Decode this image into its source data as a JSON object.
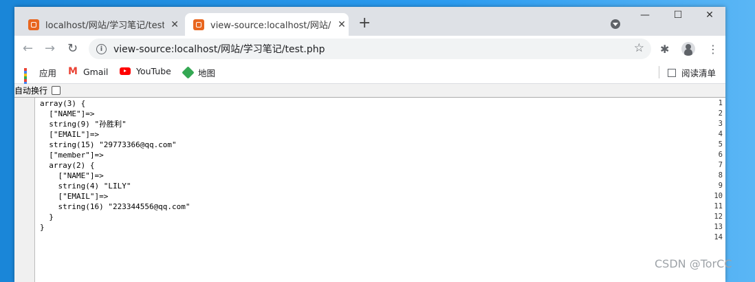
{
  "tabs": [
    {
      "title": "localhost/网站/学习笔记/test.php",
      "active": false
    },
    {
      "title": "view-source:localhost/网站/学习笔记/test.php",
      "active": true
    }
  ],
  "window_controls": {
    "minimize": "—",
    "maximize": "☐",
    "close": "✕"
  },
  "toolbar": {
    "back": "←",
    "forward": "→",
    "reload": "↻",
    "url": "view-source:localhost/网站/学习笔记/test.php",
    "star": "☆",
    "extensions": "✱",
    "menu": "⋮"
  },
  "bookmarks": [
    {
      "label": "应用",
      "icon": "apps-grid-icon"
    },
    {
      "label": "Gmail",
      "icon": "gmail-icon"
    },
    {
      "label": "YouTube",
      "icon": "youtube-icon"
    },
    {
      "label": "地图",
      "icon": "maps-icon"
    }
  ],
  "reading_list": "阅读清单",
  "source_view": {
    "wrap_label": "自动换行",
    "wrap_checked": false,
    "lines": [
      "array(3) {",
      "  [\"NAME\"]=>",
      "  string(9) \"孙胜利\"",
      "  [\"EMAIL\"]=>",
      "  string(15) \"29773366@qq.com\"",
      "  [\"member\"]=>",
      "  array(2) {",
      "    [\"NAME\"]=>",
      "    string(4) \"LILY\"",
      "    [\"EMAIL\"]=>",
      "    string(16) \"223344556@qq.com\"",
      "  }",
      "}",
      ""
    ]
  },
  "watermark": "CSDN @TorCC",
  "colors": {
    "favicon": "#e8661f",
    "tabstrip": "#dee1e6",
    "desktop": "#1a86d8"
  }
}
